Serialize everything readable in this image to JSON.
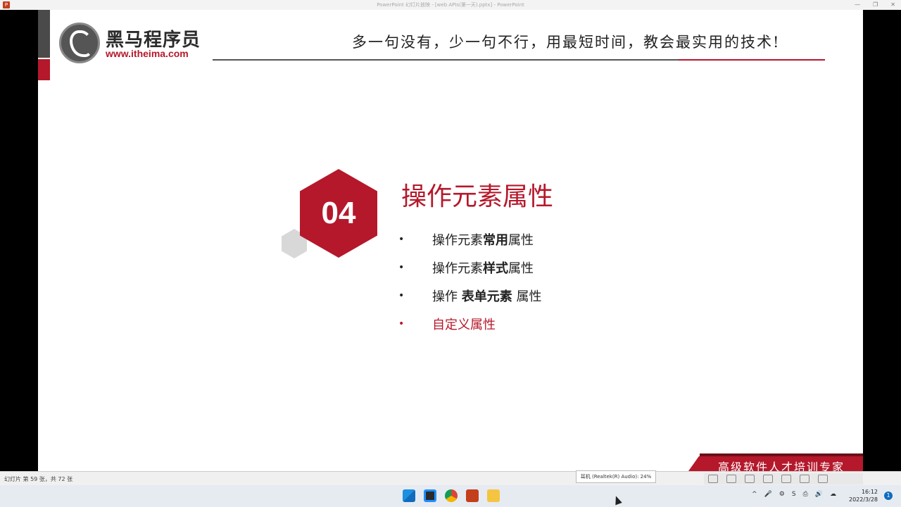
{
  "window": {
    "title": "PowerPoint 幻灯片放映 - [web APIs(第一天).pptx] - PowerPoint",
    "app_icon": "P"
  },
  "slide": {
    "logo_name": "黑马程序员",
    "logo_url": "www.itheima.com",
    "slogan": "多一句没有，少一句不行，用最短时间，教会最实用的技术!",
    "section_number": "04",
    "section_title": "操作元素属性",
    "bullets": [
      {
        "marker": "•",
        "pre": "操作元素",
        "bold": "常用",
        "post": "属性"
      },
      {
        "marker": "•",
        "pre": "操作元素",
        "bold": "样式",
        "post": "属性"
      },
      {
        "marker": "•",
        "pre": "操作 ",
        "bold": "表单元素",
        "post": " 属性"
      },
      {
        "marker": "•",
        "pre": "自定义属性",
        "bold": "",
        "post": ""
      }
    ],
    "footer_banner": "高级软件人才培训专家",
    "colors": {
      "brand_red": "#b5182b",
      "dark_gray": "#4a4a4a"
    }
  },
  "statusbar": {
    "slide_count": "幻灯片 第 59 张，共 72 张",
    "volume_tooltip": "耳机 (Realtek(R) Audio): 24%"
  },
  "taskbar": {
    "icons": [
      "start-icon",
      "snap-icon",
      "chrome-icon",
      "powerpoint-icon",
      "folder-icon"
    ],
    "tray": [
      "^",
      "🎤",
      "⚙",
      "S",
      "⎙",
      "🔊",
      "☁"
    ],
    "time": "16:12",
    "date": "2022/3/28",
    "notification": "1"
  }
}
